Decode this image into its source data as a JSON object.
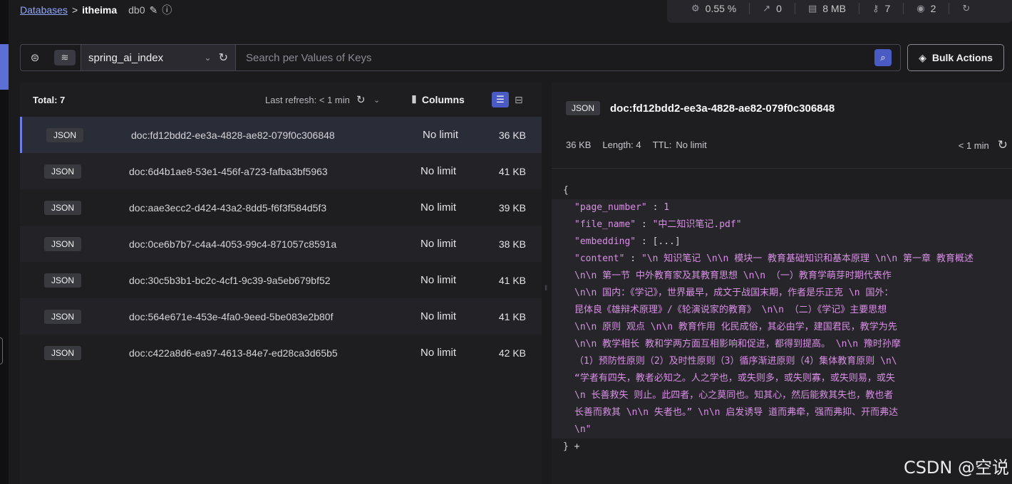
{
  "breadcrumb": {
    "root": "Databases",
    "separator": ">",
    "database": "itheima",
    "db_id": "db0",
    "edit_icon": "pencil-icon",
    "info_icon": "info-icon"
  },
  "stats": {
    "cpu": "0.55 %",
    "ops": "0",
    "memory": "8 MB",
    "keys": "7",
    "clients": "2"
  },
  "filter": {
    "index_name": "spring_ai_index",
    "search_placeholder": "Search per Values of Keys",
    "bulk_actions_label": "Bulk Actions"
  },
  "list": {
    "total_label": "Total: 7",
    "last_refresh_label": "Last refresh:",
    "last_refresh_value": "< 1 min",
    "columns_label": "Columns",
    "rows": [
      {
        "type": "JSON",
        "key": "doc:fd12bdd2-ee3a-4828-ae82-079f0c306848",
        "ttl": "No limit",
        "size": "36 KB"
      },
      {
        "type": "JSON",
        "key": "doc:6d4b1ae8-53e1-456f-a723-fafba3bf5963",
        "ttl": "No limit",
        "size": "41 KB"
      },
      {
        "type": "JSON",
        "key": "doc:aae3ecc2-d424-43a2-8dd5-f6f3f584d5f3",
        "ttl": "No limit",
        "size": "39 KB"
      },
      {
        "type": "JSON",
        "key": "doc:0ce6b7b7-c4a4-4053-99c4-871057c8591a",
        "ttl": "No limit",
        "size": "38 KB"
      },
      {
        "type": "JSON",
        "key": "doc:30c5b3b1-bc2c-4cf1-9c39-9a5eb679bf52",
        "ttl": "No limit",
        "size": "41 KB"
      },
      {
        "type": "JSON",
        "key": "doc:564e671e-453e-4fa0-9eed-5be083e2b80f",
        "ttl": "No limit",
        "size": "41 KB"
      },
      {
        "type": "JSON",
        "key": "doc:c422a8d6-ea97-4613-84e7-ed28ca3d65b5",
        "ttl": "No limit",
        "size": "42 KB"
      }
    ]
  },
  "detail": {
    "type": "JSON",
    "key": "doc:fd12bdd2-ee3a-4828-ae82-079f0c306848",
    "size": "36 KB",
    "length": "Length: 4",
    "ttl_label": "TTL:",
    "ttl_value": "No limit",
    "refreshed": "< 1 min",
    "json": {
      "open": "{",
      "page_number_key": "\"page_number\"",
      "page_number_value": "1",
      "file_name_key": "\"file_name\"",
      "file_name_value": "\"中二知识笔记.pdf\"",
      "embedding_key": "\"embedding\"",
      "embedding_value": "[...]",
      "content_key": "\"content\"",
      "content_lines": [
        "\"\\n 知识笔记 \\n\\n 模块一 教育基础知识和基本原理 \\n\\n 第一章 教育概述",
        "\\n\\n 第一节 中外教育家及其教育思想 \\n\\n （一）教育学萌芽时期代表作",
        "\\n\\n 国内：《学记》，世界最早，成文于战国末期，作者是乐正克 \\n 国外：",
        "昆体良《雄辩术原理》/《轮演说家的教育》 \\n\\n （二）《学记》主要思想",
        "\\n\\n 原则 观点 \\n\\n 教育作用 化民成俗，其必由学，建国君民，教学为先",
        "\\n\\n 教学相长 教和学两方面互相影响和促进，都得到提高。 \\n\\n 豫时孙摩",
        "（1）预防性原则（2）及时性原则（3）循序渐进原则（4）集体教育原则 \\n\\",
        "“学者有四失，教者必知之。人之学也，或失则多，或失则寡，或失则易，或失",
        "\\n 长善救失 则止。此四者，心之莫同也。知其心，然后能救其失也，教也者",
        "长善而救其 \\n\\n 失者也。” \\n\\n 启发诱导 道而弗牵，强而弗抑、开而弗达",
        "\\n\""
      ],
      "close": "} +"
    }
  },
  "watermark": "CSDN @空说"
}
